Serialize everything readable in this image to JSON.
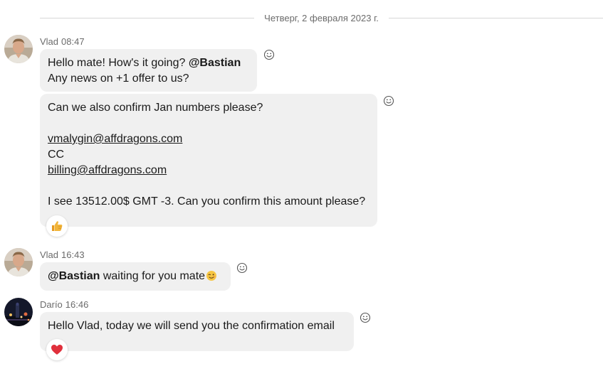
{
  "date_divider": "Четверг, 2 февраля 2023 г.",
  "messages": [
    {
      "sender": "Vlad",
      "time": "08:47",
      "bubble1": {
        "line1_text": "Hello mate! How's it going? ",
        "line1_mention": "@Bastian",
        "line2_text": "Any news on +1 offer to us?"
      },
      "bubble2": {
        "line1": "Can we also confirm Jan numbers please?",
        "email1": "vmalygin@affdragons.com",
        "cc": "CC",
        "email2": "billing@affdragons.com",
        "line_last": "I see 13512.00$ GMT -3. Can you confirm this amount please?",
        "reaction": "thumbs-up"
      }
    },
    {
      "sender": "Vlad",
      "time": "16:43",
      "bubble": {
        "mention": "@Bastian",
        "text": " waiting for you mate",
        "emoji": "wink"
      }
    },
    {
      "sender": "Darío",
      "time": "16:46",
      "bubble": {
        "text": "Hello Vlad, today we will send you the confirmation email",
        "reaction": "heart"
      }
    }
  ],
  "colors": {
    "bubble_bg": "#f0f0f0",
    "meta_text": "#6b6b6b",
    "heart": "#e0303c",
    "thumb": "#f2b53a"
  }
}
